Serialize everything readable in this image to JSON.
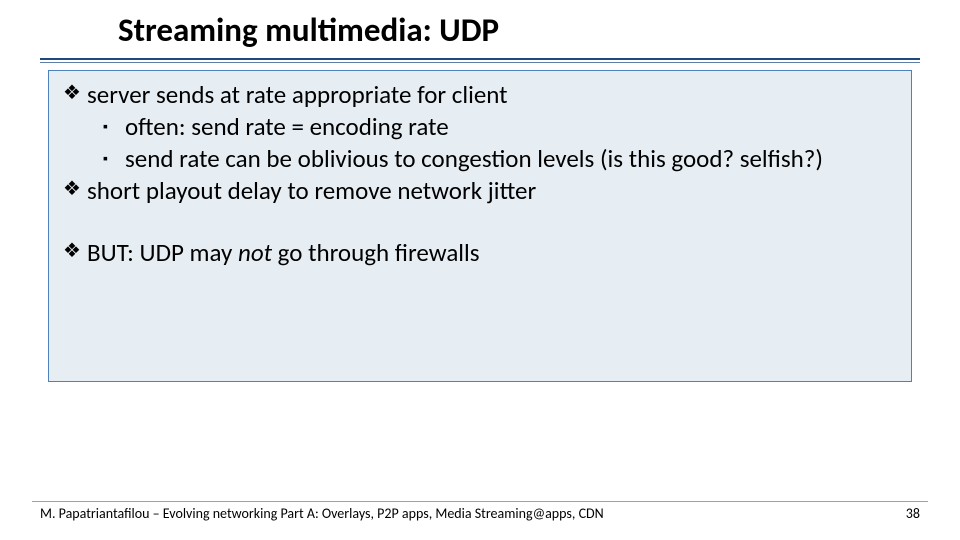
{
  "title": "Streaming multimedia: UDP",
  "bullets": {
    "b1": "server sends at rate appropriate for client",
    "b1a": "often: send rate = encoding rate",
    "b1b": "send rate can be oblivious to congestion levels (is this good? selfish?)",
    "b2": "short playout delay to remove network jitter",
    "b3_pre": "BUT: UDP may ",
    "b3_em": "not",
    "b3_post": " go through firewalls"
  },
  "glyphs": {
    "diamond": "❖",
    "square": "▪"
  },
  "footer": "M. Papatriantafilou –  Evolving networking Part A: Overlays, P2P apps, Media Streaming@apps, CDN",
  "page": "38"
}
